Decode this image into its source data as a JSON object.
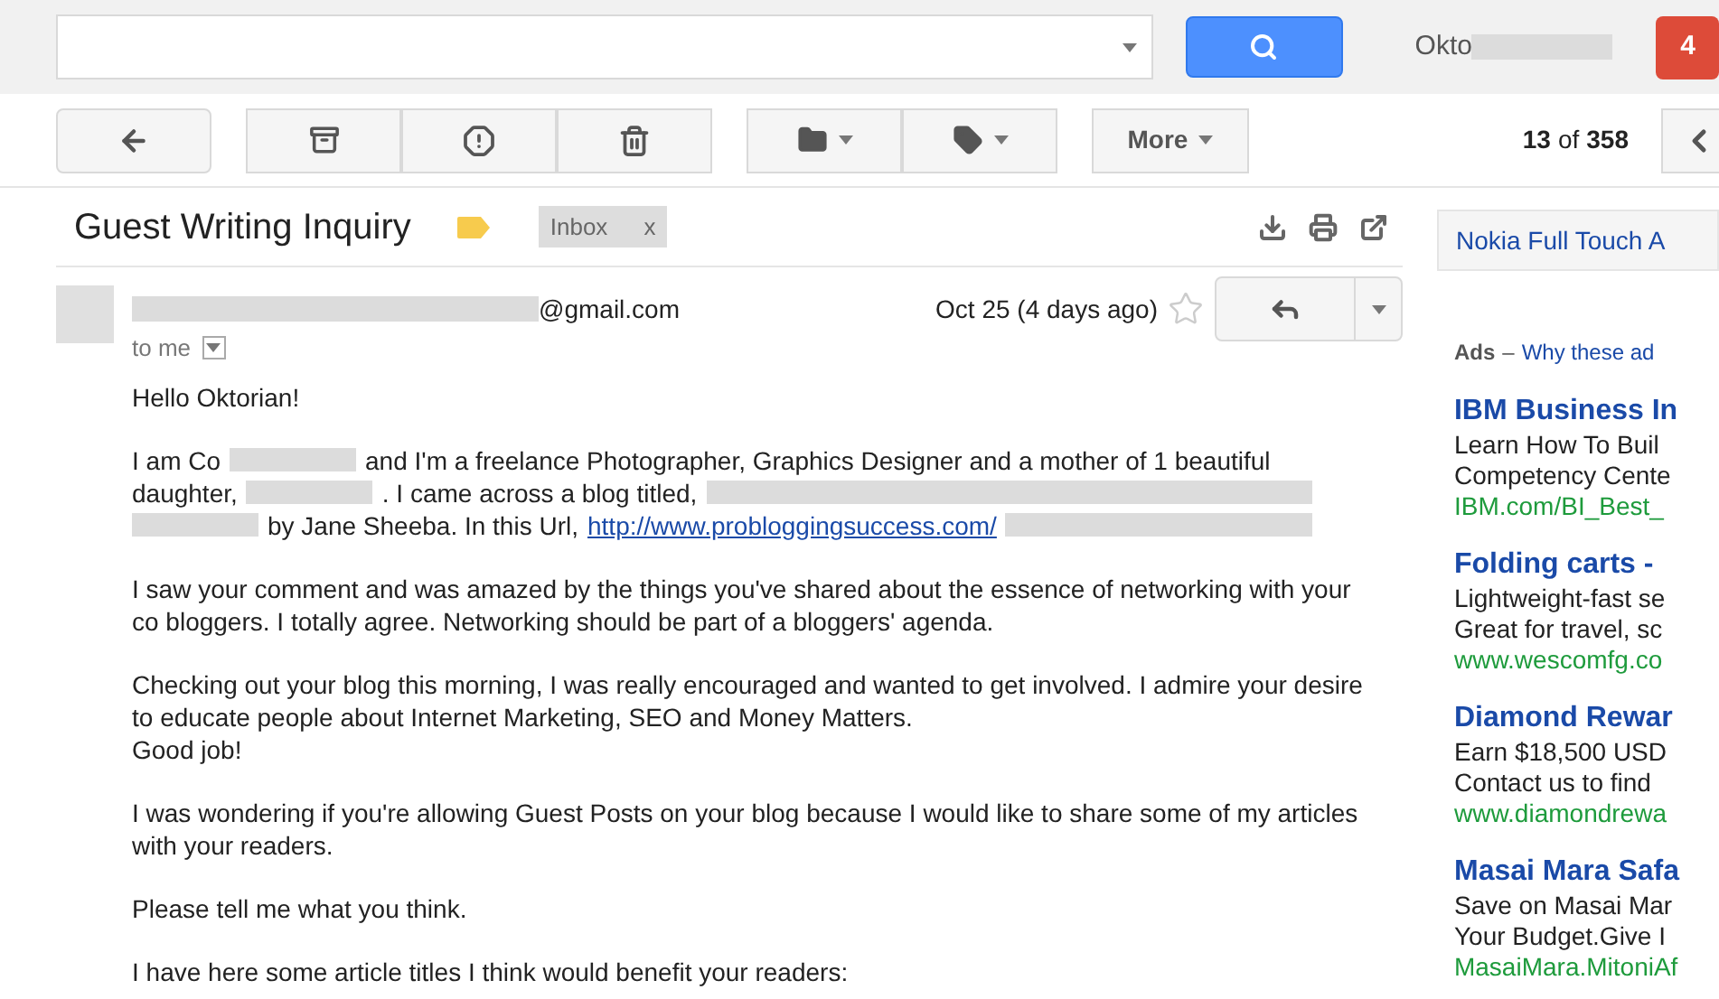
{
  "top_bar": {
    "account_name": "Okto",
    "notification_count": "4"
  },
  "toolbar": {
    "more_label": "More",
    "pager_current": "13",
    "pager_of": "of",
    "pager_total": "358"
  },
  "message": {
    "subject": "Guest Writing Inquiry",
    "label_chip": "Inbox",
    "label_remove": "x",
    "sender_email": "@gmail.com",
    "date": "Oct 25 (4 days ago)",
    "starred": false,
    "recipient": "to me",
    "paragraphs": [
      [
        {
          "kind": "text",
          "text": "Hello Oktorian!"
        }
      ],
      [
        {
          "kind": "line",
          "parts": [
            {
              "kind": "text",
              "text": "I am Co"
            },
            {
              "kind": "redacted"
            },
            {
              "kind": "text",
              "text": "and I'm a freelance Photographer, Graphics Designer and a mother of 1 beautiful"
            }
          ]
        },
        {
          "kind": "line",
          "parts": [
            {
              "kind": "text",
              "text": "daughter,"
            },
            {
              "kind": "redacted"
            },
            {
              "kind": "text",
              "text": ". I came across a blog titled,"
            },
            {
              "kind": "redacted"
            }
          ]
        },
        {
          "kind": "line",
          "parts": [
            {
              "kind": "redacted"
            },
            {
              "kind": "text",
              "text": "by Jane Sheeba. In this Url,"
            },
            {
              "kind": "link",
              "text": "http://www.probloggingsuccess.com/"
            },
            {
              "kind": "redacted"
            }
          ]
        }
      ],
      [
        {
          "kind": "text",
          "text": "I saw your comment and was amazed by the things you've shared about the essence of networking with your co bloggers. I totally agree. Networking should be part of a bloggers' agenda."
        }
      ],
      [
        {
          "kind": "text",
          "text": "Checking out your blog this morning, I was really encouraged and wanted to get involved. I admire your desire to educate people about Internet Marketing, SEO and Money Matters."
        },
        {
          "kind": "break"
        },
        {
          "kind": "text",
          "text": "Good job!"
        }
      ],
      [
        {
          "kind": "text",
          "text": "I was wondering if you're allowing Guest Posts on your blog because I would like to share some of my articles with your readers."
        }
      ],
      [
        {
          "kind": "text",
          "text": "Please tell me what you think."
        }
      ],
      [
        {
          "kind": "text",
          "text": "I have here some article titles I think would benefit your readers:"
        }
      ]
    ]
  },
  "sidebar": {
    "promo": "Nokia Full Touch A",
    "ads_label": "Ads",
    "ads_dash": "–",
    "ads_link": "Why these ad",
    "ads": [
      {
        "title": "IBM Business In",
        "lines": [
          "Learn How To Buil",
          "Competency Cente"
        ],
        "url": "IBM.com/BI_Best_"
      },
      {
        "title": "Folding carts -",
        "lines": [
          "Lightweight-fast se",
          "Great for travel, sc"
        ],
        "url": "www.wescomfg.co"
      },
      {
        "title": "Diamond Rewar",
        "lines": [
          "Earn $18,500 USD",
          "Contact us to find"
        ],
        "url": "www.diamondrewa"
      },
      {
        "title": "Masai Mara Safa",
        "lines": [
          "Save on Masai Mar",
          "Your Budget.Give I"
        ],
        "url": "MasaiMara.MitoniAf"
      }
    ]
  }
}
